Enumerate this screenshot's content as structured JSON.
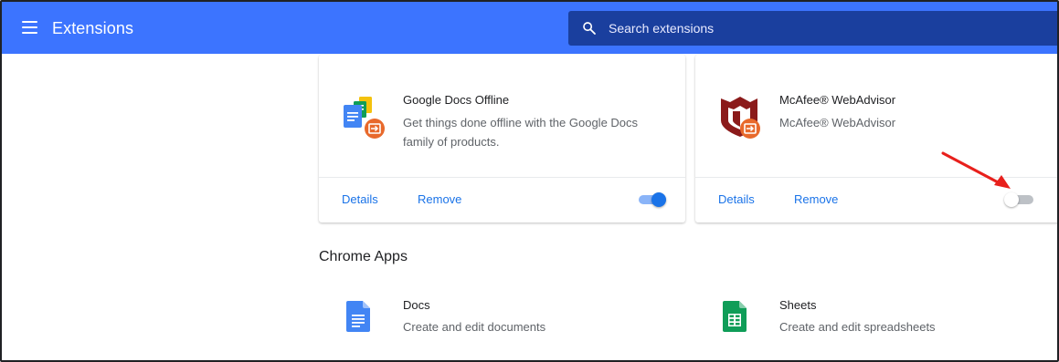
{
  "header": {
    "title": "Extensions",
    "menu_icon": "hamburger-menu-icon",
    "search": {
      "placeholder": "Search extensions",
      "icon": "search-icon"
    }
  },
  "extensions": [
    {
      "name": "Google Docs Offline",
      "description": "Get things done offline with the Google Docs family of products.",
      "icon": "google-docs-offline-icon",
      "details_label": "Details",
      "remove_label": "Remove",
      "enabled": true
    },
    {
      "name": "McAfee® WebAdvisor",
      "description": "McAfee® WebAdvisor",
      "icon": "mcafee-webadvisor-icon",
      "details_label": "Details",
      "remove_label": "Remove",
      "enabled": false
    }
  ],
  "chrome_apps": {
    "title": "Chrome Apps",
    "items": [
      {
        "name": "Docs",
        "description": "Create and edit documents",
        "icon": "google-docs-icon"
      },
      {
        "name": "Sheets",
        "description": "Create and edit spreadsheets",
        "icon": "google-sheets-icon"
      }
    ]
  },
  "annotation": {
    "arrow_color": "#e8201c",
    "icon": "red-arrow-icon"
  },
  "colors": {
    "header_bg": "#3c74ff",
    "search_bg": "#1a3f9e",
    "link": "#1a73e8",
    "toggle_on": "#1a73e8"
  }
}
